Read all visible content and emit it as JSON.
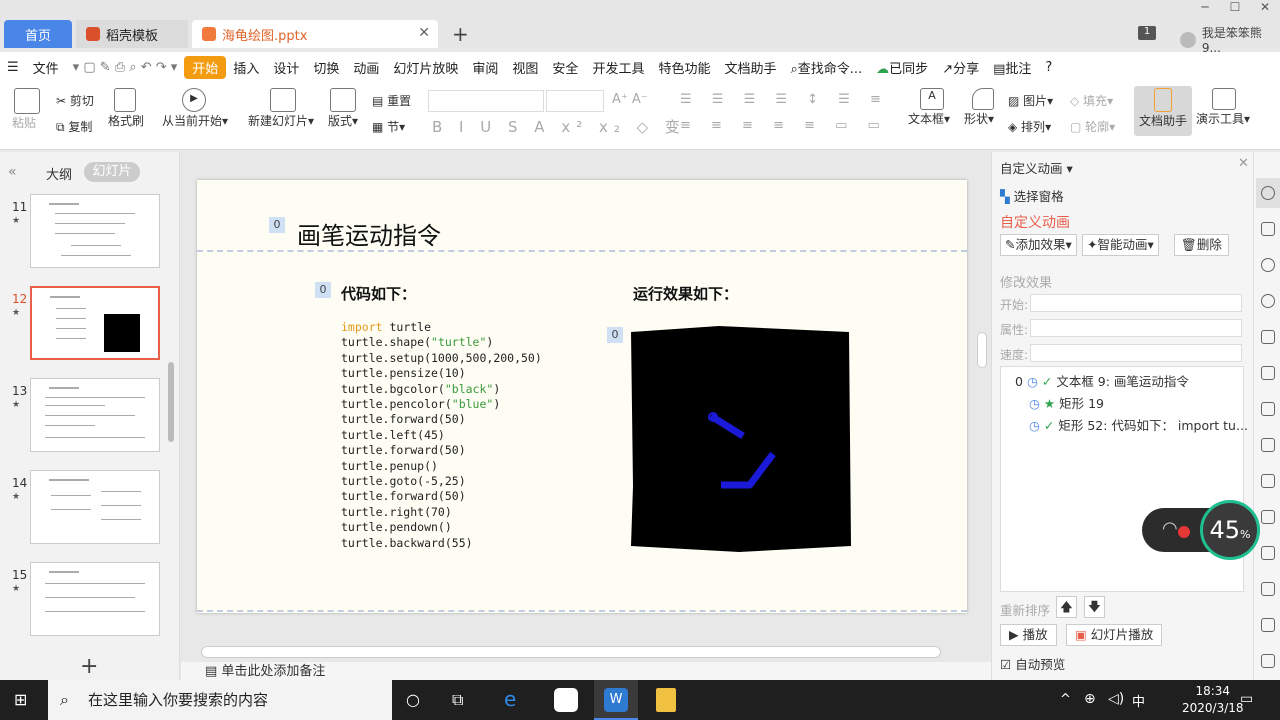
{
  "tabs": {
    "home": "首页",
    "docer": "稻壳模板",
    "file": "海龟绘图.pptx"
  },
  "user": {
    "badge": "1",
    "name": "我是笨笨熊9..."
  },
  "menu": {
    "file": "文件",
    "items": [
      "开始",
      "插入",
      "设计",
      "切换",
      "动画",
      "幻灯片放映",
      "审阅",
      "视图",
      "安全",
      "开发工具",
      "特色功能",
      "文档助手"
    ],
    "search": "查找命令...",
    "sync": "已同步",
    "share": "分享",
    "comment": "批注"
  },
  "ribbon": {
    "paste": "粘贴",
    "cut": "剪切",
    "copy": "复制",
    "format_painter": "格式刷",
    "from_current": "从当前开始",
    "new_slide": "新建幻灯片",
    "layout": "版式",
    "reset": "重置",
    "section": "节",
    "textbox": "文本框",
    "shape": "形状",
    "picture": "图片",
    "arrange": "排列",
    "fill": "填充",
    "outline": "轮廓",
    "doc_assistant": "文档助手",
    "present_tools": "演示工具"
  },
  "left": {
    "outline": "大纲",
    "slides": "幻灯片",
    "thumbs": [
      "11",
      "12",
      "13",
      "14",
      "15"
    ]
  },
  "slide": {
    "title": "画笔运动指令",
    "code_head": "代码如下：",
    "result_head": "运行效果如下：",
    "tag0": "0",
    "code": [
      [
        "import",
        " turtle"
      ],
      [
        "turtle.shape(",
        "\"turtle\"",
        ")"
      ],
      [
        "turtle.setup(1000,500,200,50)"
      ],
      [
        "turtle.pensize(10)"
      ],
      [
        "turtle.bgcolor(",
        "\"black\"",
        ")"
      ],
      [
        "turtle.pencolor(",
        "\"blue\"",
        ")"
      ],
      [
        "turtle.forward(50)"
      ],
      [
        "turtle.left(45)"
      ],
      [
        "turtle.forward(50)"
      ],
      [
        "turtle.penup()"
      ],
      [
        "turtle.goto(-5,25)"
      ],
      [
        "turtle.forward(50)"
      ],
      [
        "turtle.right(70)"
      ],
      [
        "turtle.pendown()"
      ],
      [
        "turtle.backward(55)"
      ]
    ]
  },
  "notes": "单击此处添加备注",
  "panel": {
    "header": "自定义动画",
    "select_pane": "选择窗格",
    "title": "自定义动画",
    "add_effect": "添加效果",
    "smart_anim": "智能动画",
    "delete": "删除",
    "modify": "修改效果",
    "start": "开始:",
    "property": "属性:",
    "speed": "速度:",
    "items": [
      {
        "num": "0",
        "label": "文本框 9: 画笔运动指令"
      },
      {
        "num": "",
        "label": "矩形 19"
      },
      {
        "num": "",
        "label": "矩形 52: 代码如下：   import tu..."
      }
    ],
    "reorder": "重新排序",
    "play": "播放",
    "slideshow": "幻灯片播放",
    "autopreview": "自动预览"
  },
  "widget": {
    "percent": "45",
    "unit": "%"
  },
  "taskbar": {
    "search": "在这里输入你要搜索的内容",
    "time": "18:34",
    "date": "2020/3/18",
    "ime": "中"
  }
}
